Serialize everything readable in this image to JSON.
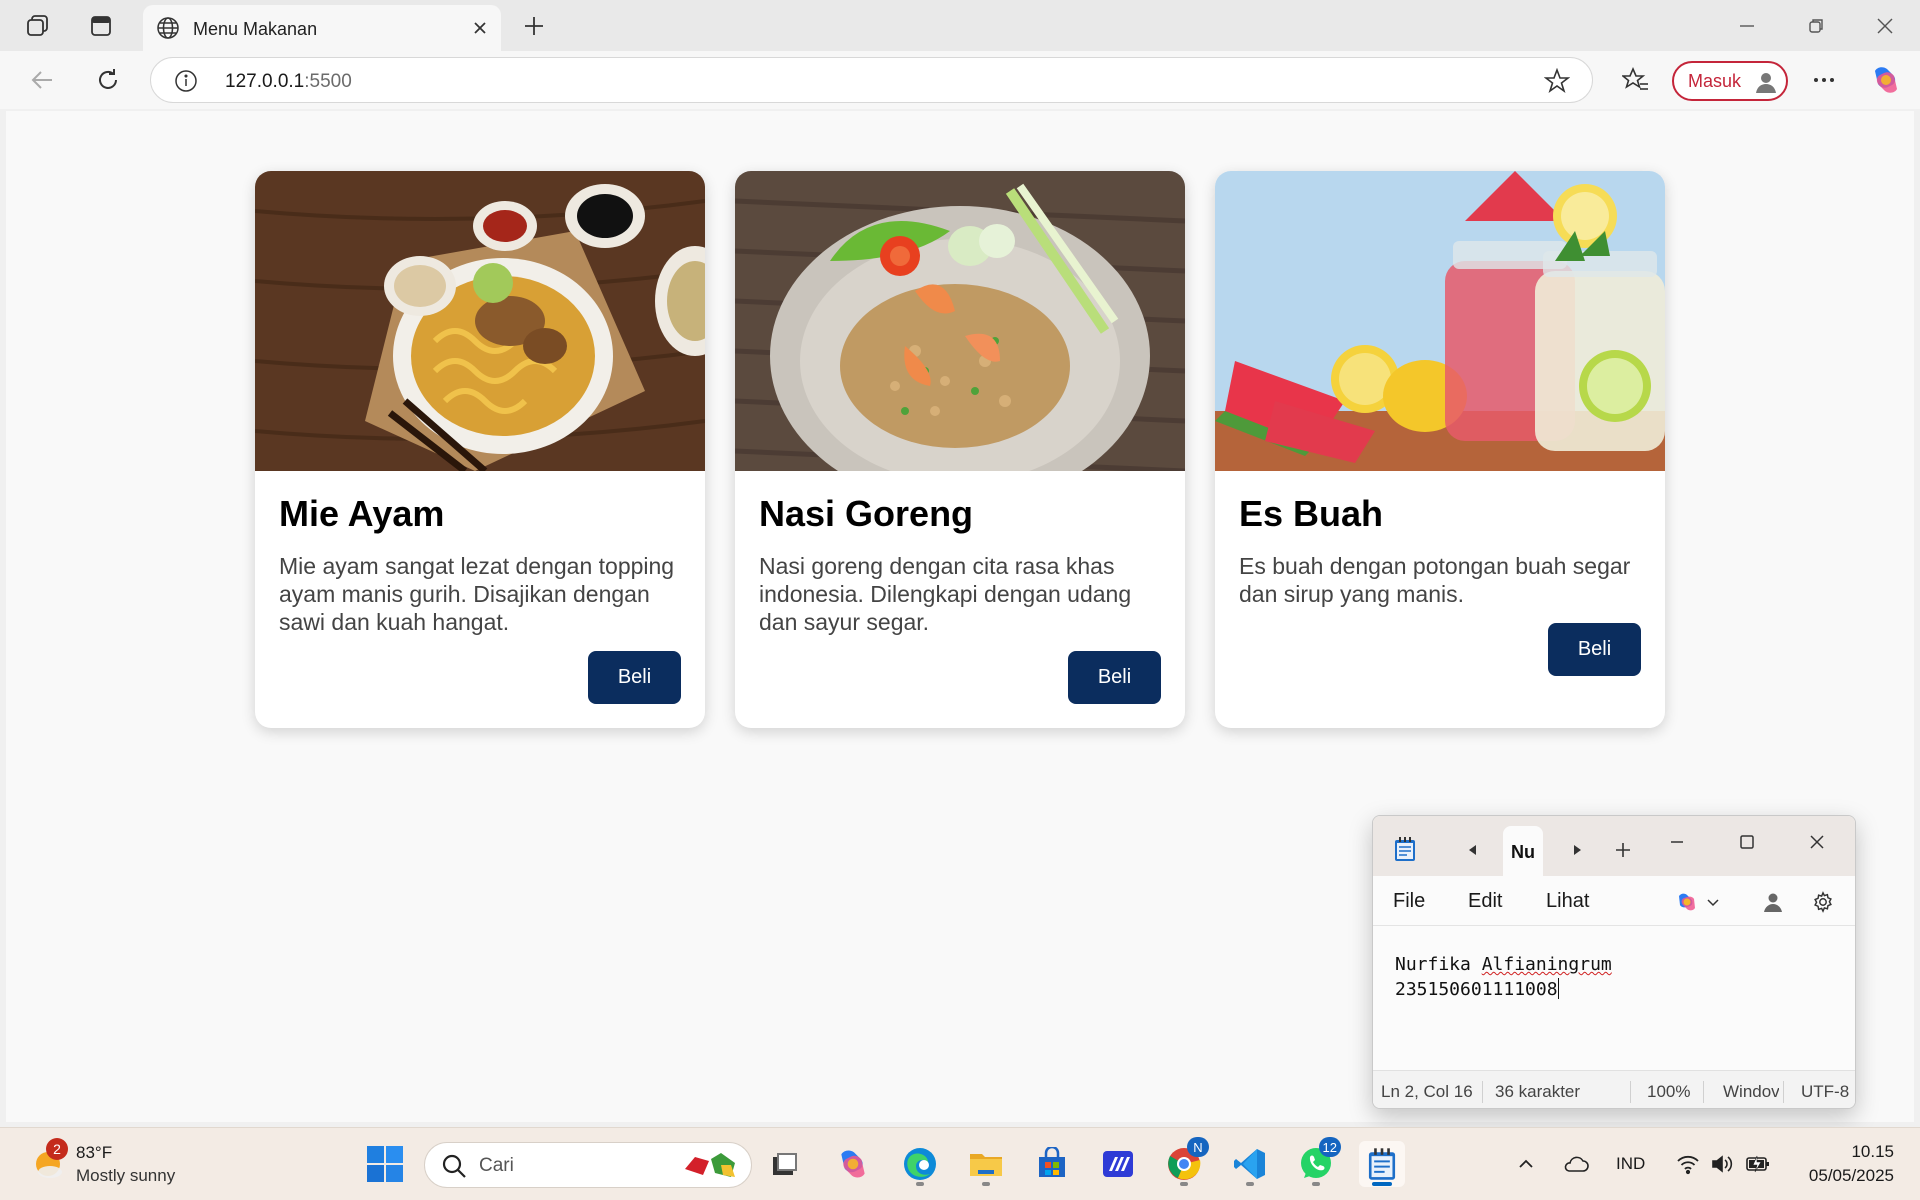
{
  "browser": {
    "tab_title": "Menu Makanan",
    "url_host": "127.0.0.1",
    "url_port": ":5500",
    "signin_label": "Masuk"
  },
  "menu": {
    "items": [
      {
        "name": "Mie Ayam",
        "description": "Mie ayam sangat lezat dengan topping ayam manis gurih. Disajikan dengan sawi dan kuah hangat.",
        "button": "Beli"
      },
      {
        "name": "Nasi Goreng",
        "description": "Nasi goreng dengan cita rasa khas indonesia. Dilengkapi dengan udang dan sayur segar.",
        "button": "Beli"
      },
      {
        "name": "Es Buah",
        "description": "Es buah dengan potongan buah segar dan sirup yang manis.",
        "button": "Beli"
      }
    ]
  },
  "notepad": {
    "tab_label": "Nu",
    "menu": [
      "File",
      "Edit",
      "Lihat"
    ],
    "line1_first": "Nurfika",
    "line1_second": "Alfianingrum",
    "line2": "235150601111008",
    "status": {
      "position": "Ln 2, Col 16",
      "chars": "36 karakter",
      "zoom": "100%",
      "line_ending": "Windov",
      "encoding": "UTF-8"
    }
  },
  "taskbar": {
    "weather_temp": "83°F",
    "weather_desc": "Mostly sunny",
    "weather_badge": "2",
    "search_placeholder": "Cari",
    "chrome_badge": "N",
    "whatsapp_badge": "12",
    "language": "IND",
    "time": "10.15",
    "date": "05/05/2025"
  },
  "colors": {
    "button_bg": "#0b2d5e",
    "signin_accent": "#c4253a",
    "taskbar_bg": "#f3ebe4"
  }
}
